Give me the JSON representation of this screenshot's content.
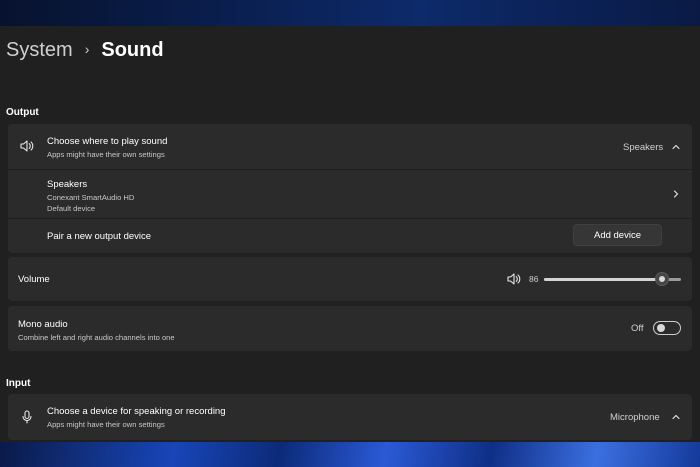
{
  "breadcrumb": {
    "parent": "System",
    "separator": "›",
    "current": "Sound"
  },
  "output": {
    "heading": "Output",
    "choose": {
      "title": "Choose where to play sound",
      "subtitle": "Apps might have their own settings",
      "selected": "Speakers",
      "icon": "speaker-icon"
    },
    "device": {
      "name": "Speakers",
      "driver": "Conexant SmartAudio HD",
      "status": "Default device"
    },
    "pair": {
      "label": "Pair a new output device",
      "button": "Add device"
    },
    "volume": {
      "label": "Volume",
      "value": "86",
      "level": 0.86
    },
    "mono": {
      "title": "Mono audio",
      "subtitle": "Combine left and right audio channels into one",
      "state": "Off"
    }
  },
  "input": {
    "heading": "Input",
    "choose": {
      "title": "Choose a device for speaking or recording",
      "subtitle": "Apps might have their own settings",
      "selected": "Microphone",
      "icon": "microphone-icon"
    }
  },
  "colors": {
    "window": "#202020",
    "card": "#2b2b2b",
    "text": "#ffffff",
    "subtext": "#c8c8c8"
  }
}
